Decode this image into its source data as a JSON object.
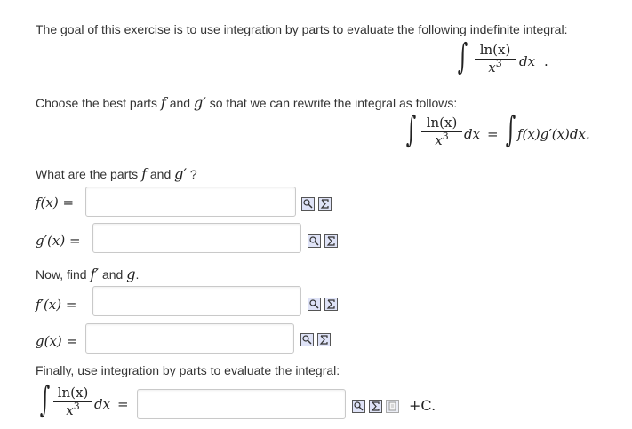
{
  "intro_text": "The goal of this exercise is to use integration by parts to evaluate the following indefinite integral:",
  "integral": {
    "integral_sign": "∫",
    "numerator": "ln(x)",
    "denominator_base": "x",
    "denominator_exp": "3",
    "dx": "dx",
    "period": "."
  },
  "choose_text": "Choose the best parts",
  "choose_f": "f",
  "choose_and": "and",
  "choose_g": "g",
  "choose_prime": "′",
  "choose_suffix": "so that we can rewrite the integral as follows:",
  "rewrite_equals": "=",
  "rewrite_rhs": "f(x)g′(x)dx.",
  "parts_question_prefix": "What are the parts",
  "parts_question_and": "and",
  "parts_question_suffix": "?",
  "fields": [
    {
      "label": "f(x) =",
      "value": ""
    },
    {
      "label": "g′(x) =",
      "value": ""
    },
    {
      "label": "f′(x) =",
      "value": ""
    },
    {
      "label": "g(x) =",
      "value": ""
    }
  ],
  "find_text_prefix": "Now, find",
  "find_text_and": "and",
  "find_text_suffix": ".",
  "finally_text": "Finally, use integration by parts to evaluate the integral:",
  "final_equals": "=",
  "constant_label": "+C.",
  "tool_icons": [
    "preview-icon",
    "sigma-icon",
    "help-icon"
  ]
}
